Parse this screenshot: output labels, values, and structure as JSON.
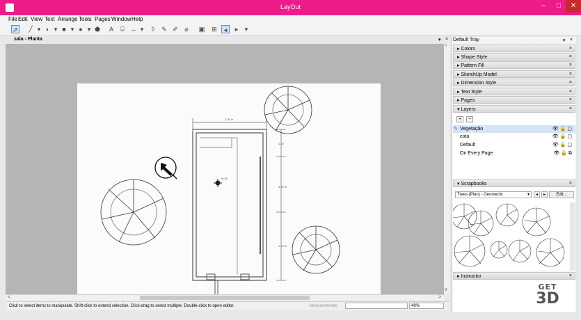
{
  "window": {
    "title": "LayOut",
    "minimize": "–",
    "maximize": "□",
    "close": "✕"
  },
  "menu": [
    "File",
    "Edit",
    "View",
    "Text",
    "Arrange",
    "Tools",
    "Pages",
    "Window",
    "Help"
  ],
  "document": {
    "tab_label": "sala - Planta",
    "pin": "▾",
    "close": "×"
  },
  "drawing": {
    "dimensions": [
      "2,00 m",
      "4,00",
      "3,25 m",
      "2,25 m"
    ],
    "level_label": "+0.00"
  },
  "status": {
    "hint": "Click to select items to manipulate. Shift-click to extend selection. Click-drag to select multiple. Double-click to open editor.",
    "measurements_label": "Measurements",
    "measurements_value": "",
    "zoom": "49%"
  },
  "tray": {
    "title": "Default Tray",
    "pin": "▾",
    "close": "×",
    "panels": [
      {
        "label": "Colors",
        "expanded": false
      },
      {
        "label": "Shape Style",
        "expanded": false
      },
      {
        "label": "Pattern Fill",
        "expanded": false
      },
      {
        "label": "SketchUp Model",
        "expanded": false
      },
      {
        "label": "Dimension Style",
        "expanded": false
      },
      {
        "label": "Text Style",
        "expanded": false
      },
      {
        "label": "Pages",
        "expanded": false
      },
      {
        "label": "Layers",
        "expanded": true
      }
    ],
    "layers": {
      "add": "+",
      "remove": "−",
      "rows": [
        {
          "name": "Vegetação",
          "selected": true
        },
        {
          "name": "cota",
          "selected": false
        },
        {
          "name": "Default",
          "selected": false
        },
        {
          "name": "On Every Page",
          "selected": false
        }
      ]
    },
    "scrapbooks": {
      "label": "Scrapbooks",
      "selected_set": "Trees (Plan) - Geometric",
      "edit_label": "Edit..."
    },
    "instructor": {
      "label": "Instructor"
    },
    "watermark": {
      "line1": "GET",
      "line2": "3D"
    }
  },
  "colors": {
    "titlebar": "#ec1c8b",
    "close": "#c7292f",
    "selection": "#d5e4f7"
  }
}
